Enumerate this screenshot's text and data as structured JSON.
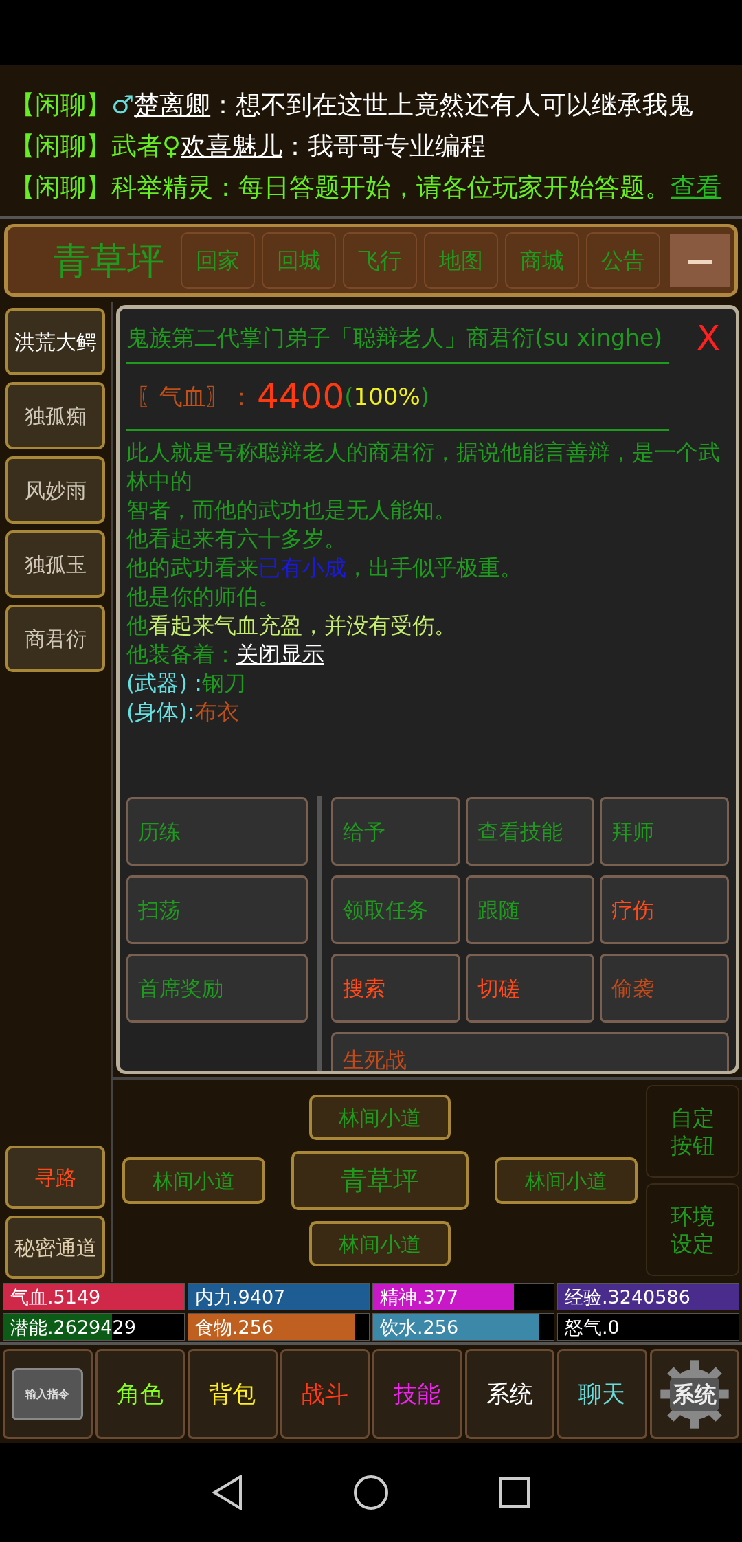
{
  "chat": [
    {
      "segments": [
        {
          "text": "【闲聊】",
          "kind": "channel"
        },
        {
          "text": "♂",
          "kind": "gender"
        },
        {
          "text": "楚离卿",
          "kind": "name"
        },
        {
          "text": "：想不到在这世上竟然还有人可以继承我鬼",
          "kind": "message"
        }
      ]
    },
    {
      "segments": [
        {
          "text": "【闲聊】",
          "kind": "channel"
        },
        {
          "text": "武者♀",
          "kind": "title"
        },
        {
          "text": "欢喜魅儿",
          "kind": "name"
        },
        {
          "text": "：我哥哥专业编程",
          "kind": "message"
        }
      ]
    },
    {
      "segments": [
        {
          "text": "【闲聊】",
          "kind": "channel"
        },
        {
          "text": "科举精灵：每日答题开始，请各位玩家开始答题。",
          "kind": "system"
        },
        {
          "text": "查看",
          "kind": "link"
        }
      ]
    }
  ],
  "location_bar": {
    "title": "青草坪",
    "buttons": [
      "回家",
      "回城",
      "飞行",
      "地图",
      "商城",
      "公告"
    ],
    "minimize": "—"
  },
  "npc_list": [
    {
      "label": "洪荒大鳄",
      "selected": true
    },
    {
      "label": "独孤痴",
      "selected": false
    },
    {
      "label": "风妙雨",
      "selected": false
    },
    {
      "label": "独孤玉",
      "selected": false
    },
    {
      "label": "商君衍",
      "selected": false
    }
  ],
  "side_actions": [
    {
      "label": "寻路",
      "color": "#ff4a1a"
    },
    {
      "label": "秘密通道",
      "color": "#e0d0b0"
    }
  ],
  "dialog": {
    "title": "鬼族第二代掌门弟子「聪辩老人」商君衍(su xinghe)",
    "close": "X",
    "hp": {
      "label": "〖气血〗：",
      "value": "4400",
      "open": "(",
      "percent": "100%",
      "close": ")"
    },
    "lines": [
      [
        {
          "text": "此人就是号称聪辩老人的商君衍，据说他能言善辩，是一个武林中的",
          "kind": "desc"
        }
      ],
      [
        {
          "text": "智者，而他的武功也是无人能知。",
          "kind": "desc"
        }
      ],
      [
        {
          "text": "他看起来有六十多岁。",
          "kind": "desc"
        }
      ],
      [
        {
          "text": "他的武功看来",
          "kind": "desc"
        },
        {
          "text": "已有小成",
          "kind": "rank"
        },
        {
          "text": "，出手似乎极重。",
          "kind": "desc"
        }
      ],
      [
        {
          "text": "他是你的师伯。",
          "kind": "desc"
        }
      ],
      [
        {
          "text": "他",
          "kind": "desc"
        },
        {
          "text": "看起来气血充盈，并没有受伤。",
          "kind": "status"
        }
      ],
      [
        {
          "text": "他装备着：",
          "kind": "desc"
        },
        {
          "text": "关闭显示",
          "kind": "link"
        }
      ],
      [
        {
          "text": "(武器) :",
          "kind": "slot"
        },
        {
          "text": "钢刀",
          "kind": "desc"
        }
      ],
      [
        {
          "text": "(身体):",
          "kind": "slot"
        },
        {
          "text": "布衣",
          "kind": "armor"
        }
      ]
    ],
    "left_actions": [
      {
        "label": "历练",
        "color": "#1f9a1f"
      },
      {
        "label": "扫荡",
        "color": "#1f9a1f"
      },
      {
        "label": "首席奖励",
        "color": "#1f9a1f"
      }
    ],
    "actions": [
      {
        "label": "给予",
        "color": "#1f9a1f"
      },
      {
        "label": "查看技能",
        "color": "#1f9a1f"
      },
      {
        "label": "拜师",
        "color": "#1f9a1f"
      },
      {
        "label": "领取任务",
        "color": "#1f9a1f"
      },
      {
        "label": "跟随",
        "color": "#1f9a1f"
      },
      {
        "label": "疗伤",
        "color": "#ff4a1a"
      },
      {
        "label": "搜索",
        "color": "#ff4a1a"
      },
      {
        "label": "切磋",
        "color": "#ff4a1a"
      },
      {
        "label": "偷袭",
        "color": "#c04a1a"
      },
      {
        "label": "生死战",
        "color": "#c04a1a"
      }
    ]
  },
  "exits": {
    "north": "林间小道",
    "west": "林间小道",
    "here": "青草坪",
    "east": "林间小道",
    "south": "林间小道"
  },
  "settings_buttons": [
    "自定按钮",
    "环境设定"
  ],
  "stats": [
    {
      "label": "气血.5149",
      "color": "#d02848",
      "level": 1
    },
    {
      "label": "内力.9407",
      "color": "#1e5c94",
      "level": 1
    },
    {
      "label": "精神.377",
      "color": "#c818c8",
      "level": 0.78
    },
    {
      "label": "经验.3240586",
      "color": "#4a2c8c",
      "level": 1
    },
    {
      "label": "潜能.2629429",
      "color": "#0c5c18",
      "level": 0.6
    },
    {
      "label": "食物.256",
      "color": "#c06020",
      "level": 0.92
    },
    {
      "label": "饮水.256",
      "color": "#3c88a8",
      "level": 0.92
    },
    {
      "label": "怒气.0"
    }
  ],
  "command_button": "输入指令",
  "nav": [
    {
      "label": "角色",
      "color": "#88ff22"
    },
    {
      "label": "背包",
      "color": "#ffee22"
    },
    {
      "label": "战斗",
      "color": "#ff3a1a"
    },
    {
      "label": "技能",
      "color": "#ee22ee"
    },
    {
      "label": "系统",
      "color": "#ffffff"
    },
    {
      "label": "聊天",
      "color": "#66dddd"
    }
  ],
  "gear_button": "系统"
}
